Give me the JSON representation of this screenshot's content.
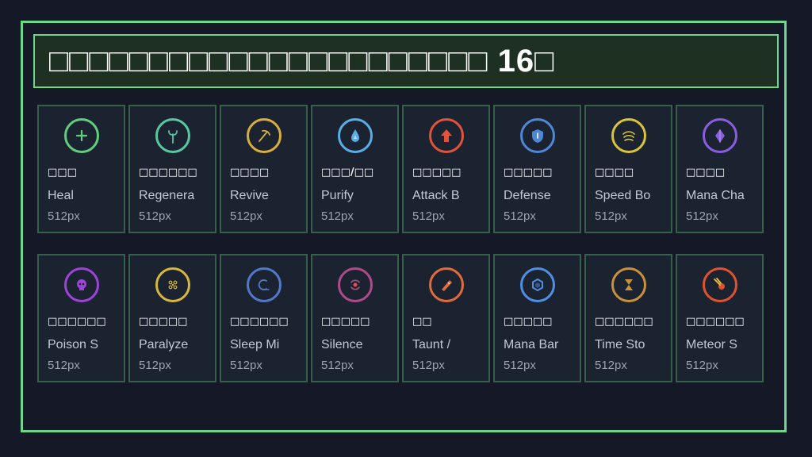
{
  "title": "□□□□□□□□□□□□□□□□□□□□□□ 16□",
  "cards": [
    {
      "jp": "□□□",
      "en": "Heal",
      "size": "512px",
      "icon": "plus-icon",
      "color": "#5fcf7e"
    },
    {
      "jp": "□□□□□□",
      "en": "Regenera",
      "size": "512px",
      "icon": "regen-icon",
      "color": "#57c9a0"
    },
    {
      "jp": "□□□□",
      "en": "Revive",
      "size": "512px",
      "icon": "revive-icon",
      "color": "#d9ae3d"
    },
    {
      "jp": "□□□/□□",
      "en": "Purify",
      "size": "512px",
      "icon": "drop-icon",
      "color": "#5aaee6"
    },
    {
      "jp": "□□□□□",
      "en": "Attack B",
      "size": "512px",
      "icon": "arrow-up-icon",
      "color": "#e2533a"
    },
    {
      "jp": "□□□□□",
      "en": "Defense",
      "size": "512px",
      "icon": "shield-icon",
      "color": "#4f86d6"
    },
    {
      "jp": "□□□□",
      "en": "Speed Bo",
      "size": "512px",
      "icon": "wind-icon",
      "color": "#d9c43a"
    },
    {
      "jp": "□□□□",
      "en": "Mana Cha",
      "size": "512px",
      "icon": "crystal-icon",
      "color": "#8a5ce0"
    },
    {
      "jp": "□□□□□□",
      "en": "Poison S",
      "size": "512px",
      "icon": "skull-icon",
      "color": "#9b45d6"
    },
    {
      "jp": "□□□□□",
      "en": "Paralyze",
      "size": "512px",
      "icon": "sparks-icon",
      "color": "#d6b83a"
    },
    {
      "jp": "□□□□□□",
      "en": "Sleep Mi",
      "size": "512px",
      "icon": "moon-icon",
      "color": "#5478c9"
    },
    {
      "jp": "□□□□□",
      "en": "Silence",
      "size": "512px",
      "icon": "silence-icon",
      "color": "#b04a8a"
    },
    {
      "jp": "□□",
      "en": "Taunt /",
      "size": "512px",
      "icon": "taunt-icon",
      "color": "#e36a3a"
    },
    {
      "jp": "□□□□□",
      "en": "Mana Bar",
      "size": "512px",
      "icon": "hexagon-icon",
      "color": "#4f8ee0"
    },
    {
      "jp": "□□□□□□",
      "en": "Time Sto",
      "size": "512px",
      "icon": "hourglass-icon",
      "color": "#c9913a"
    },
    {
      "jp": "□□□□□□",
      "en": "Meteor S",
      "size": "512px",
      "icon": "meteor-icon",
      "color": "#e0522e"
    }
  ]
}
